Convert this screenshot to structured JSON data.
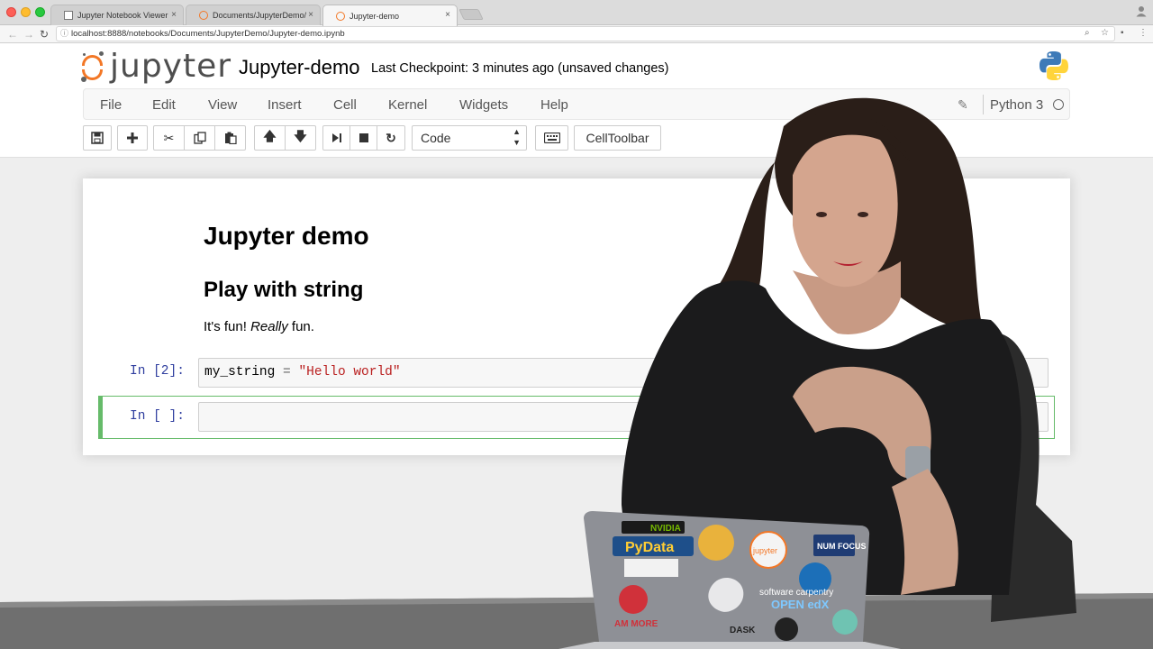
{
  "browser": {
    "tabs": [
      {
        "label": "Jupyter Notebook Viewer",
        "icon": "document-icon",
        "active": false
      },
      {
        "label": "Documents/JupyterDemo/",
        "icon": "jupyter-icon",
        "active": false
      },
      {
        "label": "Jupyter-demo",
        "icon": "jupyter-icon",
        "active": true
      }
    ],
    "close_glyph": "×",
    "url": "localhost:8888/notebooks/Documents/JupyterDemo/Jupyter-demo.ipynb"
  },
  "header": {
    "logo_text": "jupyter",
    "notebook_title": "Jupyter-demo",
    "checkpoint": "Last Checkpoint: 3 minutes ago (unsaved changes)"
  },
  "menu": {
    "items": [
      "File",
      "Edit",
      "View",
      "Insert",
      "Cell",
      "Kernel",
      "Widgets",
      "Help"
    ],
    "kernel_name": "Python 3"
  },
  "toolbar": {
    "cell_type": "Code",
    "celltoolbar_label": "CellToolbar"
  },
  "notebook": {
    "h1": "Jupyter demo",
    "h2": "Play with string",
    "paragraph": {
      "before": "It's fun! ",
      "emph": "Really",
      "after": " fun."
    },
    "cells": [
      {
        "prompt": "In [2]:",
        "code_var": "my_string",
        "code_op": " = ",
        "code_str": "\"Hello world\""
      },
      {
        "prompt": "In [ ]:",
        "code": ""
      }
    ]
  },
  "colors": {
    "jupyter_orange": "#f37726",
    "prompt_blue": "#303f9f",
    "edit_green": "#66bb6a",
    "string_red": "#ba2121"
  }
}
